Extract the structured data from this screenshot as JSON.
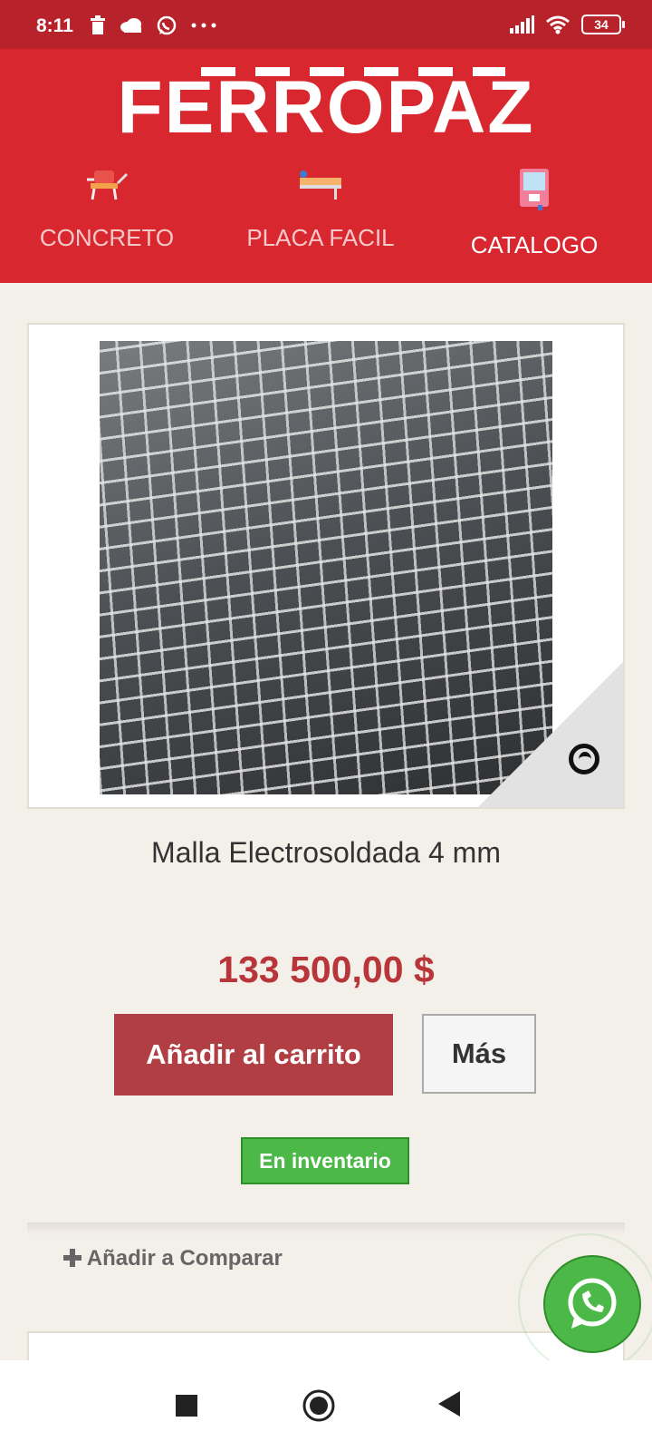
{
  "status_bar": {
    "time": "8:11",
    "battery": "34",
    "icons": [
      "trash-icon",
      "cloud-icon",
      "whatsapp-icon",
      "more-dots-icon",
      "signal-icon",
      "wifi-icon",
      "battery-icon"
    ]
  },
  "header": {
    "logo": "FERROPAZ",
    "nav": [
      {
        "label": "CONCRETO",
        "icon": "mixer-cart-icon"
      },
      {
        "label": "PLACA FACIL",
        "icon": "slab-icon"
      },
      {
        "label": "CATALOGO",
        "icon": "catalog-book-icon"
      }
    ]
  },
  "product": {
    "title": "Malla Electrosoldada 4 mm",
    "price": "133 500,00 $",
    "add_to_cart": "Añadir al carrito",
    "more": "Más",
    "stock": "En inventario",
    "compare": "Añadir a Comparar"
  },
  "colors": {
    "brand_red": "#d8272e",
    "status_red": "#b8232b",
    "price_red": "#b8353a",
    "cart_button": "#b03e43",
    "stock_green": "#4cb848"
  }
}
